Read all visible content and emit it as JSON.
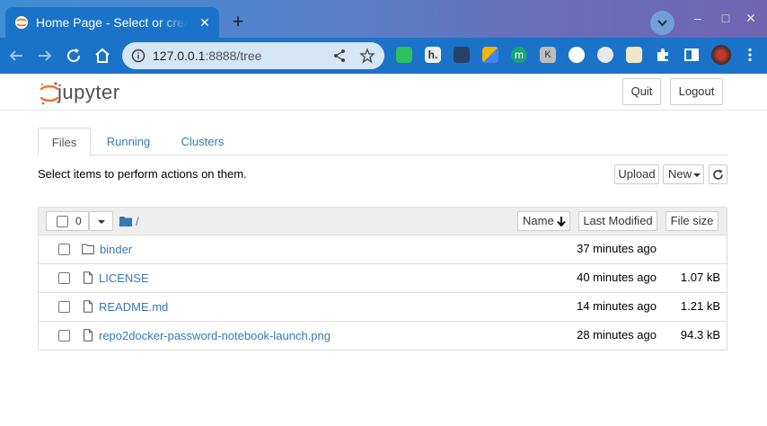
{
  "browser": {
    "tab_title": "Home Page - Select or create a notebook",
    "tab_close": "✕",
    "new_tab": "+",
    "url_host": "127.0.0.1",
    "url_rest": ":8888/tree",
    "window_controls": {
      "minimize": "–",
      "maximize": "□",
      "close": "✕"
    },
    "colors": {
      "tabbar_start": "#3d8fd6",
      "tabbar_end": "#7165b0",
      "toolbar": "#1a73c8",
      "omnibox": "#d5e6f7"
    }
  },
  "header": {
    "logo_text": "jupyter",
    "quit_label": "Quit",
    "logout_label": "Logout"
  },
  "tabs": [
    {
      "label": "Files",
      "active": true
    },
    {
      "label": "Running",
      "active": false
    },
    {
      "label": "Clusters",
      "active": false
    }
  ],
  "toolbar": {
    "hint": "Select items to perform actions on them.",
    "upload_label": "Upload",
    "new_label": "New"
  },
  "list_header": {
    "selected_count": "0",
    "path": "/",
    "name_label": "Name",
    "last_modified_label": "Last Modified",
    "file_size_label": "File size"
  },
  "files": [
    {
      "type": "folder",
      "name": "binder",
      "modified": "37 minutes ago",
      "size": ""
    },
    {
      "type": "file",
      "name": "LICENSE",
      "modified": "40 minutes ago",
      "size": "1.07 kB"
    },
    {
      "type": "file",
      "name": "README.md",
      "modified": "14 minutes ago",
      "size": "1.21 kB"
    },
    {
      "type": "file",
      "name": "repo2docker-password-notebook-launch.png",
      "modified": "28 minutes ago",
      "size": "94.3 kB"
    }
  ],
  "extensions": [
    "evernote-icon",
    "h-icon",
    "dark-icon",
    "map-pin-icon",
    "m-icon",
    "k-icon",
    "lock-badge-icon",
    "gear-badge-icon",
    "clipboard-icon",
    "puzzle-icon",
    "sidebar-icon",
    "avatar"
  ]
}
